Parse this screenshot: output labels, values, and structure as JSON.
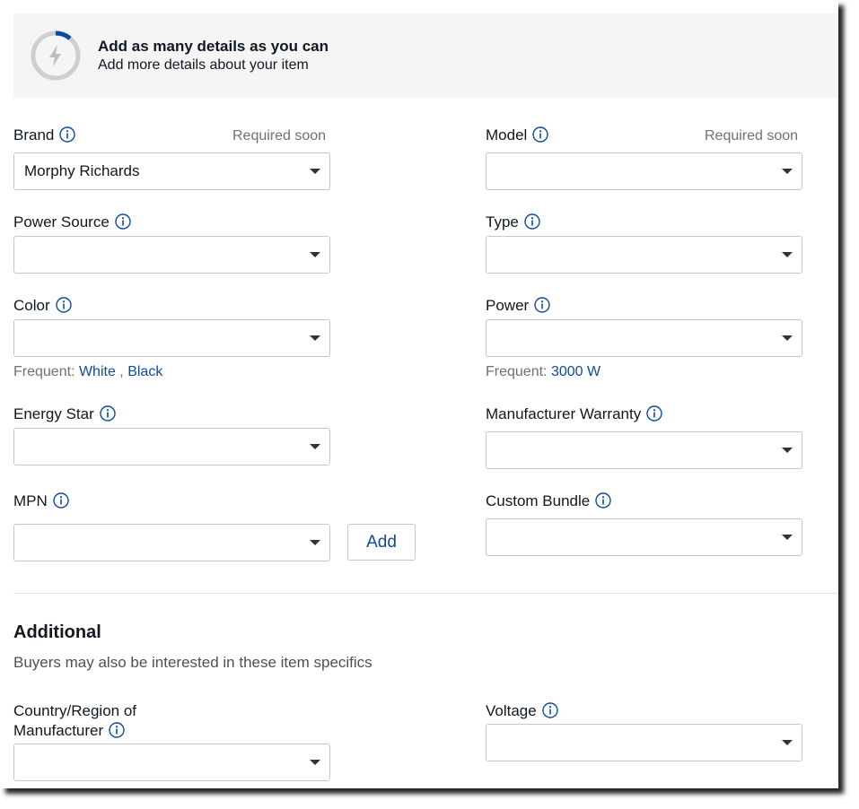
{
  "banner": {
    "title": "Add as many details as you can",
    "subtitle": "Add more details about your item",
    "icon": "lightning-icon",
    "ring_color": "#c7c7c7",
    "ring_accent": "#0e4a9e"
  },
  "colors": {
    "text": "#111820",
    "muted": "#707070",
    "link": "#0e4a9e",
    "border": "#c7c7c7",
    "banner_bg": "#f5f5f5"
  },
  "fields": {
    "brand": {
      "label": "Brand",
      "required": "Required soon",
      "value": "Morphy Richards"
    },
    "model": {
      "label": "Model",
      "required": "Required soon",
      "value": ""
    },
    "power_source": {
      "label": "Power Source",
      "value": ""
    },
    "type": {
      "label": "Type",
      "value": ""
    },
    "color": {
      "label": "Color",
      "value": "",
      "frequent_label": "Frequent:",
      "frequent": [
        "White",
        "Black"
      ],
      "separator": ","
    },
    "power": {
      "label": "Power",
      "value": "",
      "frequent_label": "Frequent:",
      "frequent": [
        "3000 W"
      ]
    },
    "energy_star": {
      "label": "Energy Star",
      "value": ""
    },
    "manufacturer_warranty": {
      "label": "Manufacturer Warranty",
      "value": ""
    },
    "mpn": {
      "label": "MPN",
      "value": "",
      "add_label": "Add"
    },
    "custom_bundle": {
      "label": "Custom Bundle",
      "value": ""
    }
  },
  "additional": {
    "title": "Additional",
    "subtitle": "Buyers may also be interested in these item specifics",
    "fields": {
      "country": {
        "label_line1": "Country/Region of",
        "label_line2": "Manufacturer",
        "value": ""
      },
      "voltage": {
        "label": "Voltage",
        "value": ""
      }
    }
  }
}
